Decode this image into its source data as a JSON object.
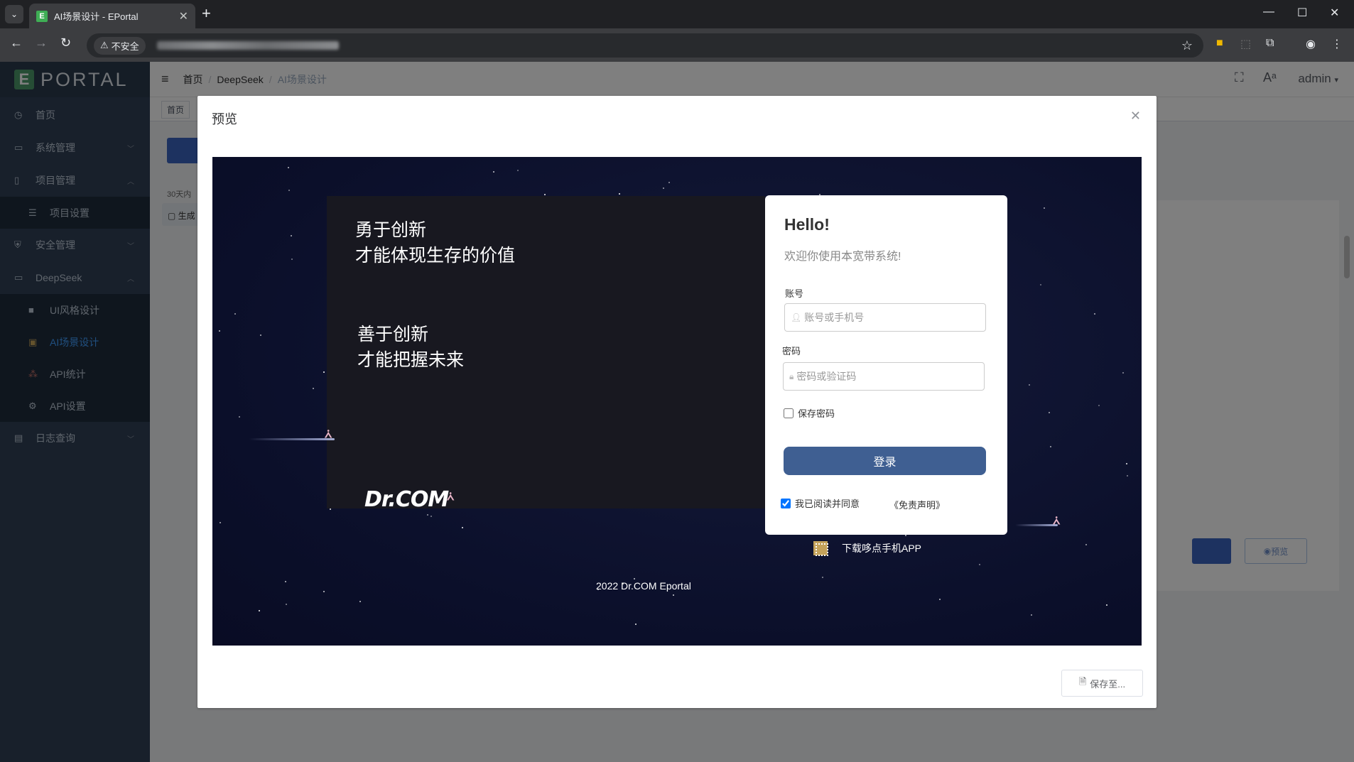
{
  "browser": {
    "tab_title": "AI场景设计 - EPortal",
    "favicon_letter": "E",
    "security_label": "不安全"
  },
  "sidebar": {
    "logo_letter": "E",
    "logo_text": "PORTAL",
    "items": [
      {
        "label": "首页"
      },
      {
        "label": "系统管理"
      },
      {
        "label": "项目管理"
      },
      {
        "label": "项目设置"
      },
      {
        "label": "安全管理"
      },
      {
        "label": "DeepSeek"
      },
      {
        "label": "UI风格设计"
      },
      {
        "label": "AI场景设计"
      },
      {
        "label": "API统计"
      },
      {
        "label": "API设置"
      },
      {
        "label": "日志查询"
      }
    ]
  },
  "header": {
    "breadcrumb": [
      "首页",
      "DeepSeek",
      "AI场景设计"
    ],
    "user": "admin"
  },
  "tags": {
    "home": "首页"
  },
  "background": {
    "range_label": "30天内",
    "row_label": "生成",
    "preview_button": "预览"
  },
  "dialog": {
    "title": "预览",
    "save_button": "保存至..."
  },
  "preview": {
    "slogan1_line1": "勇于创新",
    "slogan1_line2": "才能体现生存的价值",
    "slogan2_line1": "善于创新",
    "slogan2_line2": "才能把握未来",
    "brand": "Dr.COM",
    "login": {
      "hello": "Hello!",
      "welcome": "欢迎你使用本宽带系统!",
      "account_label": "账号",
      "account_placeholder": "账号或手机号",
      "password_label": "密码",
      "password_placeholder": "密码或验证码",
      "remember": "保存密码",
      "remember_checked": false,
      "submit": "登录",
      "agree": "我已阅读并同意",
      "agree_checked": true,
      "disclaimer": "《免责声明》"
    },
    "app_download": "下载哆点手机APP",
    "copyright": "2022 Dr.COM Eportal"
  }
}
